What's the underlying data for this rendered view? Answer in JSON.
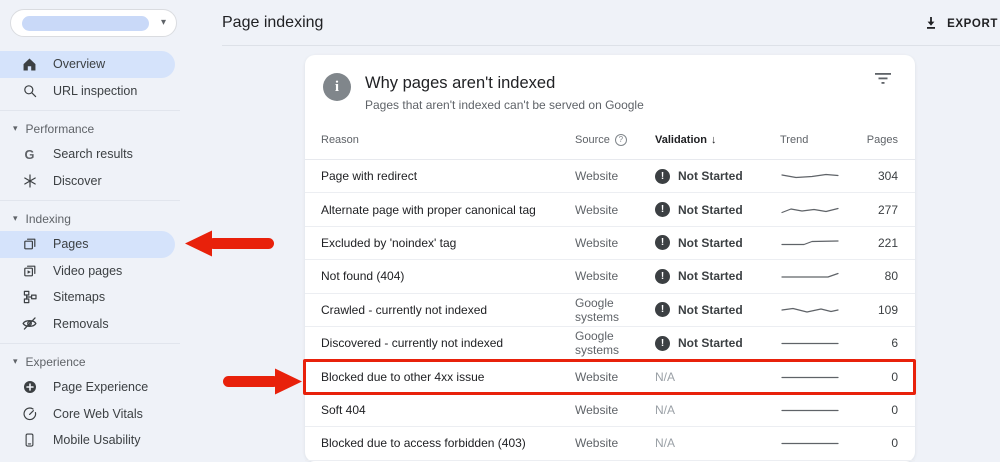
{
  "colors": {
    "annotation_red": "#e8210b",
    "selected_pill_blue": "#d5e3fb",
    "badge_dark": "#3c4043",
    "page_bg": "#eff2f8",
    "card_bg": "#ffffff"
  },
  "icons": {
    "caret_down": "▾",
    "sort_desc": "↓",
    "exclamation": "!",
    "info": "i",
    "help": "?"
  },
  "sidebar": {
    "sections": [
      {
        "header": null,
        "items": [
          {
            "icon": "home-icon",
            "label": "Overview",
            "selected": true
          },
          {
            "icon": "search-icon",
            "label": "URL inspection",
            "selected": false
          }
        ]
      },
      {
        "header": "Performance",
        "items": [
          {
            "icon": "google-g-icon",
            "label": "Search results",
            "selected": false
          },
          {
            "icon": "discover-icon",
            "label": "Discover",
            "selected": false
          }
        ]
      },
      {
        "header": "Indexing",
        "items": [
          {
            "icon": "pages-icon",
            "label": "Pages",
            "selected": true
          },
          {
            "icon": "video-pages-icon",
            "label": "Video pages",
            "selected": false
          },
          {
            "icon": "sitemaps-icon",
            "label": "Sitemaps",
            "selected": false
          },
          {
            "icon": "removals-icon",
            "label": "Removals",
            "selected": false
          }
        ]
      },
      {
        "header": "Experience",
        "items": [
          {
            "icon": "page-experience-icon",
            "label": "Page Experience",
            "selected": false
          },
          {
            "icon": "core-web-vitals-icon",
            "label": "Core Web Vitals",
            "selected": false
          },
          {
            "icon": "mobile-usability-icon",
            "label": "Mobile Usability",
            "selected": false
          }
        ]
      }
    ]
  },
  "topbar": {
    "title": "Page indexing",
    "export_label": "EXPORT"
  },
  "card": {
    "title": "Why pages aren't indexed",
    "subtitle": "Pages that aren't indexed can't be served on Google",
    "columns": {
      "reason": "Reason",
      "source": "Source",
      "validation": "Validation",
      "trend": "Trend",
      "pages": "Pages"
    },
    "rows": [
      {
        "reason": "Page with redirect",
        "source": "Website",
        "validation": "Not Started",
        "validation_state": "not_started",
        "pages": "304",
        "highlighted": false,
        "trend": [
          [
            2,
            6
          ],
          [
            16,
            8.5
          ],
          [
            32,
            7.5
          ],
          [
            46,
            5.5
          ],
          [
            58,
            6.5
          ]
        ]
      },
      {
        "reason": "Alternate page with proper canonical tag",
        "source": "Website",
        "validation": "Not Started",
        "validation_state": "not_started",
        "pages": "277",
        "highlighted": false,
        "trend": [
          [
            2,
            9.5
          ],
          [
            11,
            6
          ],
          [
            22,
            8
          ],
          [
            34,
            6.5
          ],
          [
            46,
            8.5
          ],
          [
            58,
            5.5
          ]
        ]
      },
      {
        "reason": "Excluded by 'noindex' tag",
        "source": "Website",
        "validation": "Not Started",
        "validation_state": "not_started",
        "pages": "221",
        "highlighted": false,
        "trend": [
          [
            2,
            8.5
          ],
          [
            24,
            8.5
          ],
          [
            32,
            5.5
          ],
          [
            58,
            5
          ]
        ]
      },
      {
        "reason": "Not found (404)",
        "source": "Website",
        "validation": "Not Started",
        "validation_state": "not_started",
        "pages": "80",
        "highlighted": false,
        "trend": [
          [
            2,
            8
          ],
          [
            38,
            8
          ],
          [
            48,
            8
          ],
          [
            58,
            4.5
          ]
        ]
      },
      {
        "reason": "Crawled - currently not indexed",
        "source": "Google systems",
        "validation": "Not Started",
        "validation_state": "not_started",
        "pages": "109",
        "highlighted": false,
        "trend": [
          [
            2,
            7
          ],
          [
            13,
            5.5
          ],
          [
            27,
            9
          ],
          [
            41,
            6
          ],
          [
            51,
            8.5
          ],
          [
            58,
            7
          ]
        ]
      },
      {
        "reason": "Discovered - currently not indexed",
        "source": "Google systems",
        "validation": "Not Started",
        "validation_state": "not_started",
        "pages": "6",
        "highlighted": false,
        "trend": [
          [
            2,
            7.5
          ],
          [
            58,
            7.5
          ]
        ]
      },
      {
        "reason": "Blocked due to other 4xx issue",
        "source": "Website",
        "validation": "N/A",
        "validation_state": "na",
        "pages": "0",
        "highlighted": true,
        "trend": [
          [
            2,
            7.5
          ],
          [
            58,
            7.5
          ]
        ]
      },
      {
        "reason": "Soft 404",
        "source": "Website",
        "validation": "N/A",
        "validation_state": "na",
        "pages": "0",
        "highlighted": false,
        "trend": [
          [
            2,
            7.5
          ],
          [
            58,
            7.5
          ]
        ]
      },
      {
        "reason": "Blocked due to access forbidden (403)",
        "source": "Website",
        "validation": "N/A",
        "validation_state": "na",
        "pages": "0",
        "highlighted": false,
        "trend": [
          [
            2,
            7.5
          ],
          [
            58,
            7.5
          ]
        ]
      }
    ]
  }
}
